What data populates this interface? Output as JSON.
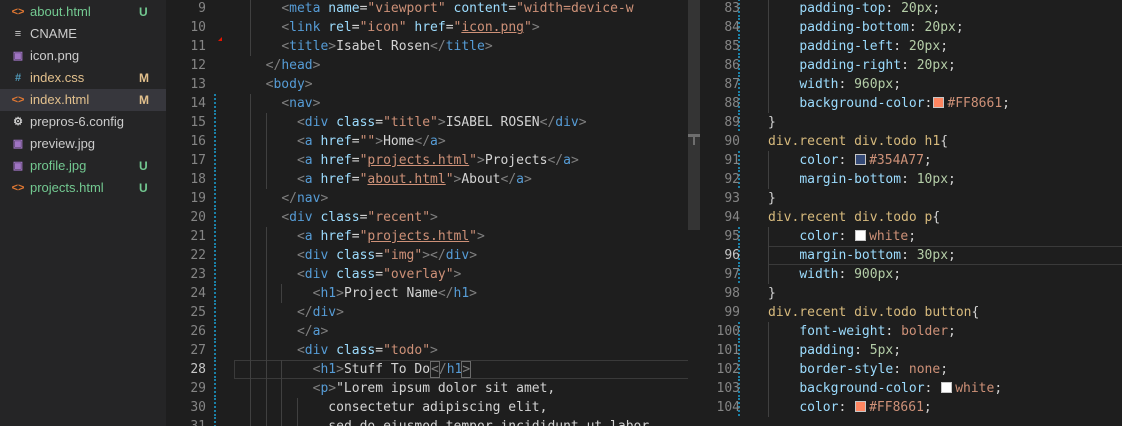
{
  "explorer": {
    "files": [
      {
        "name": "about.html",
        "icon": "<>",
        "icon_name": "html-file-icon",
        "badge": "U",
        "name_color": "#73c991",
        "icon_color": "#e37933",
        "badge_color": "#73c991",
        "active": false
      },
      {
        "name": "CNAME",
        "icon": "≡",
        "icon_name": "text-file-icon",
        "badge": "",
        "name_color": "#cccccc",
        "icon_color": "#cccccc",
        "badge_color": "#cccccc",
        "active": false
      },
      {
        "name": "icon.png",
        "icon": "▣",
        "icon_name": "image-file-icon",
        "badge": "",
        "name_color": "#cccccc",
        "icon_color": "#a074c4",
        "badge_color": "#cccccc",
        "active": false
      },
      {
        "name": "index.css",
        "icon": "#",
        "icon_name": "css-file-icon",
        "badge": "M",
        "name_color": "#e2c08d",
        "icon_color": "#519aba",
        "badge_color": "#e2c08d",
        "active": false
      },
      {
        "name": "index.html",
        "icon": "<>",
        "icon_name": "html-file-icon",
        "badge": "M",
        "name_color": "#e2c08d",
        "icon_color": "#e37933",
        "badge_color": "#e2c08d",
        "active": true
      },
      {
        "name": "prepros-6.config",
        "icon": "⚙",
        "icon_name": "gear-icon",
        "badge": "",
        "name_color": "#cccccc",
        "icon_color": "#cccccc",
        "badge_color": "#cccccc",
        "active": false
      },
      {
        "name": "preview.jpg",
        "icon": "▣",
        "icon_name": "image-file-icon",
        "badge": "",
        "name_color": "#cccccc",
        "icon_color": "#a074c4",
        "badge_color": "#cccccc",
        "active": false
      },
      {
        "name": "profile.jpg",
        "icon": "▣",
        "icon_name": "image-file-icon",
        "badge": "U",
        "name_color": "#73c991",
        "icon_color": "#a074c4",
        "badge_color": "#73c991",
        "active": false
      },
      {
        "name": "projects.html",
        "icon": "<>",
        "icon_name": "html-file-icon",
        "badge": "U",
        "name_color": "#73c991",
        "icon_color": "#e37933",
        "badge_color": "#73c991",
        "active": false
      }
    ]
  },
  "html_editor": {
    "current_line": "28",
    "lines": [
      {
        "num": "9",
        "indent": 4,
        "html": "<span class=\"p\">&lt;</span><span class=\"t\">meta</span> <span class=\"a\">name</span>=<span class=\"s\">\"viewport\"</span> <span class=\"a\">content</span>=<span class=\"s\">\"width=device-w</span>"
      },
      {
        "num": "10",
        "indent": 4,
        "html": "<span class=\"p\">&lt;</span><span class=\"t\">link</span> <span class=\"a\">rel</span>=<span class=\"s\">\"icon\"</span> <span class=\"a\">href</span>=<span class=\"s\">\"<span class=\"u\">icon.png</span>\"</span><span class=\"p\">&gt;</span>"
      },
      {
        "num": "11",
        "indent": 4,
        "html": "<span class=\"p\">&lt;</span><span class=\"t\">title</span><span class=\"p\">&gt;</span>Isabel Rosen<span class=\"p\">&lt;/</span><span class=\"t\">title</span><span class=\"p\">&gt;</span>"
      },
      {
        "num": "12",
        "indent": 2,
        "html": "<span class=\"p\">&lt;/</span><span class=\"t\">head</span><span class=\"p\">&gt;</span>"
      },
      {
        "num": "13",
        "indent": 2,
        "html": "<span class=\"p\">&lt;</span><span class=\"t\">body</span><span class=\"p\">&gt;</span>"
      },
      {
        "num": "14",
        "indent": 4,
        "html": "<span class=\"p\">&lt;</span><span class=\"t\">nav</span><span class=\"p\">&gt;</span>"
      },
      {
        "num": "15",
        "indent": 6,
        "html": "<span class=\"p\">&lt;</span><span class=\"t\">div</span> <span class=\"a\">class</span>=<span class=\"s\">\"title\"</span><span class=\"p\">&gt;</span>ISABEL ROSEN<span class=\"p\">&lt;/</span><span class=\"t\">div</span><span class=\"p\">&gt;</span>"
      },
      {
        "num": "16",
        "indent": 6,
        "html": "<span class=\"p\">&lt;</span><span class=\"t\">a</span> <span class=\"a\">href</span>=<span class=\"s\">\"\"</span><span class=\"p\">&gt;</span>Home<span class=\"p\">&lt;/</span><span class=\"t\">a</span><span class=\"p\">&gt;</span>"
      },
      {
        "num": "17",
        "indent": 6,
        "html": "<span class=\"p\">&lt;</span><span class=\"t\">a</span> <span class=\"a\">href</span>=<span class=\"s\">\"<span class=\"u\">projects.html</span>\"</span><span class=\"p\">&gt;</span>Projects<span class=\"p\">&lt;/</span><span class=\"t\">a</span><span class=\"p\">&gt;</span>"
      },
      {
        "num": "18",
        "indent": 6,
        "html": "<span class=\"p\">&lt;</span><span class=\"t\">a</span> <span class=\"a\">href</span>=<span class=\"s\">\"<span class=\"u\">about.html</span>\"</span><span class=\"p\">&gt;</span>About<span class=\"p\">&lt;/</span><span class=\"t\">a</span><span class=\"p\">&gt;</span>"
      },
      {
        "num": "19",
        "indent": 4,
        "html": "<span class=\"p\">&lt;/</span><span class=\"t\">nav</span><span class=\"p\">&gt;</span>"
      },
      {
        "num": "20",
        "indent": 4,
        "html": "<span class=\"p\">&lt;</span><span class=\"t\">div</span> <span class=\"a\">class</span>=<span class=\"s\">\"recent\"</span><span class=\"p\">&gt;</span>"
      },
      {
        "num": "21",
        "indent": 6,
        "html": "<span class=\"p\">&lt;</span><span class=\"t\">a</span> <span class=\"a\">href</span>=<span class=\"s\">\"<span class=\"u\">projects.html</span>\"</span><span class=\"p\">&gt;</span>"
      },
      {
        "num": "22",
        "indent": 6,
        "html": "<span class=\"p\">&lt;</span><span class=\"t\">div</span> <span class=\"a\">class</span>=<span class=\"s\">\"img\"</span><span class=\"p\">&gt;&lt;/</span><span class=\"t\">div</span><span class=\"p\">&gt;</span>"
      },
      {
        "num": "23",
        "indent": 6,
        "html": "<span class=\"p\">&lt;</span><span class=\"t\">div</span> <span class=\"a\">class</span>=<span class=\"s\">\"overlay\"</span><span class=\"p\">&gt;</span>"
      },
      {
        "num": "24",
        "indent": 8,
        "html": "<span class=\"p\">&lt;</span><span class=\"t\">h1</span><span class=\"p\">&gt;</span>Project Name<span class=\"p\">&lt;/</span><span class=\"t\">h1</span><span class=\"p\">&gt;</span>"
      },
      {
        "num": "25",
        "indent": 6,
        "html": "<span class=\"p\">&lt;/</span><span class=\"t\">div</span><span class=\"p\">&gt;</span>"
      },
      {
        "num": "26",
        "indent": 6,
        "html": "<span class=\"p\">&lt;/</span><span class=\"t\">a</span><span class=\"p\">&gt;</span>"
      },
      {
        "num": "27",
        "indent": 6,
        "html": "<span class=\"p\">&lt;</span><span class=\"t\">div</span> <span class=\"a\">class</span>=<span class=\"s\">\"todo\"</span><span class=\"p\">&gt;</span>"
      },
      {
        "num": "28",
        "indent": 8,
        "html": "<span class=\"p\">&lt;</span><span class=\"t\">h1</span><span class=\"p\">&gt;</span>Stuff To Do<span class=\"cursor\"></span><span class=\"p hl\">&lt;</span><span class=\"p\">/</span><span class=\"t\">h1</span><span class=\"p hl\">&gt;</span>"
      },
      {
        "num": "29",
        "indent": 8,
        "html": "<span class=\"p\">&lt;</span><span class=\"t\">p</span><span class=\"p\">&gt;</span>\"Lorem ipsum dolor sit amet,"
      },
      {
        "num": "30",
        "indent": 10,
        "html": "consectetur adipiscing elit,"
      },
      {
        "num": "31",
        "indent": 10,
        "html": "sed do eiusmod tempor incididunt ut labor"
      }
    ]
  },
  "css_editor": {
    "current_line": "96",
    "lines": [
      {
        "num": "83",
        "indent": 4,
        "html": "<span class=\"pr\">padding-top</span>: <span class=\"n\">20px</span>;"
      },
      {
        "num": "84",
        "indent": 4,
        "html": "<span class=\"pr\">padding-bottom</span>: <span class=\"n\">20px</span>;"
      },
      {
        "num": "85",
        "indent": 4,
        "html": "<span class=\"pr\">padding-left</span>: <span class=\"n\">20px</span>;"
      },
      {
        "num": "86",
        "indent": 4,
        "html": "<span class=\"pr\">padding-right</span>: <span class=\"n\">20px</span>;"
      },
      {
        "num": "87",
        "indent": 4,
        "html": "<span class=\"pr\">width</span>: <span class=\"n\">960px</span>;"
      },
      {
        "num": "88",
        "indent": 4,
        "html": "<span class=\"pr\">background-color</span>:<span class=\"sw\" style=\"background:#FF8661\"></span><span class=\"v\">#FF8661</span>;"
      },
      {
        "num": "89",
        "indent": 0,
        "html": "}"
      },
      {
        "num": "90",
        "indent": 0,
        "html": "<span class=\"sel\">div.recent div.todo h1</span>{"
      },
      {
        "num": "91",
        "indent": 4,
        "html": "<span class=\"pr\">color</span>: <span class=\"sw\" style=\"background:#354A77\"></span><span class=\"v\">#354A77</span>;"
      },
      {
        "num": "92",
        "indent": 4,
        "html": "<span class=\"pr\">margin-bottom</span>: <span class=\"n\">10px</span>;"
      },
      {
        "num": "93",
        "indent": 0,
        "html": "}"
      },
      {
        "num": "94",
        "indent": 0,
        "html": "<span class=\"sel\">div.recent div.todo p</span>{"
      },
      {
        "num": "95",
        "indent": 4,
        "html": "<span class=\"pr\">color</span>: <span class=\"sw\" style=\"background:#ffffff\"></span><span class=\"v\">white</span>;"
      },
      {
        "num": "96",
        "indent": 4,
        "html": "<span class=\"pr\">margin-bottom</span>: <span class=\"n\">30px</span>;"
      },
      {
        "num": "97",
        "indent": 4,
        "html": "<span class=\"pr\">width</span>: <span class=\"n\">900px</span>;"
      },
      {
        "num": "98",
        "indent": 0,
        "html": "}"
      },
      {
        "num": "99",
        "indent": 0,
        "html": "<span class=\"sel\">div.recent div.todo button</span>{"
      },
      {
        "num": "100",
        "indent": 4,
        "html": "<span class=\"pr\">font-weight</span>: <span class=\"v\">bolder</span>;"
      },
      {
        "num": "101",
        "indent": 4,
        "html": "<span class=\"pr\">padding</span>: <span class=\"n\">5px</span>;"
      },
      {
        "num": "102",
        "indent": 4,
        "html": "<span class=\"pr\">border-style</span>: <span class=\"v\">none</span>;"
      },
      {
        "num": "103",
        "indent": 4,
        "html": "<span class=\"pr\">background-color</span>: <span class=\"sw\" style=\"background:#ffffff\"></span><span class=\"v\">white</span>;"
      },
      {
        "num": "104",
        "indent": 4,
        "html": "<span class=\"pr\">color</span>: <span class=\"sw\" style=\"background:#FF8661\"></span><span class=\"v\">#FF8661</span>;"
      }
    ]
  }
}
